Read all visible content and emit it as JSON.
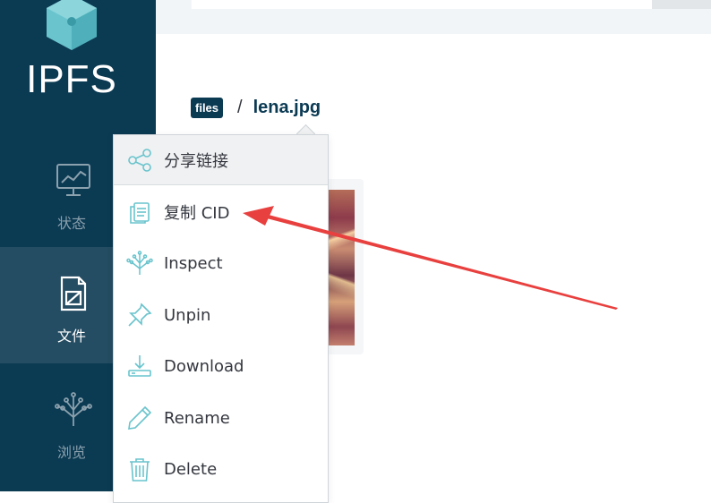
{
  "app": {
    "logo_text": "IPFS"
  },
  "sidebar": {
    "items": [
      {
        "label": "状态",
        "icon": "status-monitor-icon",
        "active": false
      },
      {
        "label": "文件",
        "icon": "files-icon",
        "active": true
      },
      {
        "label": "浏览",
        "icon": "explore-tree-icon",
        "active": false
      }
    ]
  },
  "breadcrumb": {
    "root": "files",
    "separator": "/",
    "current": "lena.jpg"
  },
  "context_menu": {
    "items": [
      {
        "label": "分享链接",
        "icon": "share-icon"
      },
      {
        "label": "复制 CID",
        "icon": "copy-icon"
      },
      {
        "label": "Inspect",
        "icon": "inspect-icon"
      },
      {
        "label": "Unpin",
        "icon": "pin-icon"
      },
      {
        "label": "Download",
        "icon": "download-icon"
      },
      {
        "label": "Rename",
        "icon": "pencil-icon"
      },
      {
        "label": "Delete",
        "icon": "trash-icon"
      }
    ]
  },
  "colors": {
    "sidebar_bg": "#0b3a53",
    "sidebar_active_bg": "#244c62",
    "accent_teal": "#69c4cd",
    "annotation_red": "#e8403e"
  }
}
